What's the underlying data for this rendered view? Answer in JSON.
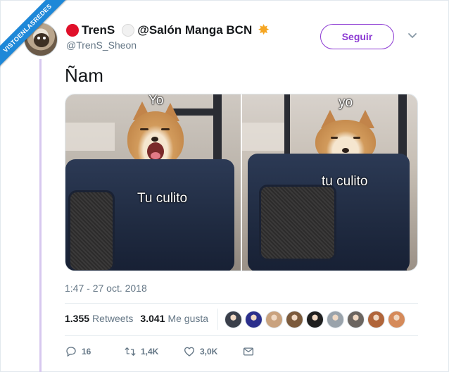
{
  "watermark": {
    "text": "VISTOENLASREDES"
  },
  "author": {
    "name_part1": "TrenS",
    "name_part2": "@Salón Manga BCN",
    "handle": "@TrenS_Sheon"
  },
  "follow_button": {
    "label": "Seguir"
  },
  "tweet": {
    "text": "Ñam",
    "timestamp": "1:47 - 27 oct. 2018"
  },
  "media": {
    "left_panel": {
      "top_label": "Yo",
      "bottom_label": "Tu culito"
    },
    "right_panel": {
      "top_label": "yo",
      "bottom_label": "tu culito"
    }
  },
  "stats": {
    "retweets_count": "1.355",
    "retweets_label": "Retweets",
    "likes_count": "3.041",
    "likes_label": "Me gusta"
  },
  "likers": [
    {
      "color": "#3a3f4a"
    },
    {
      "color": "#2b2f8c"
    },
    {
      "color": "#c9a27e"
    },
    {
      "color": "#7b5a3c"
    },
    {
      "color": "#1f1f1f"
    },
    {
      "color": "#9aa3ab"
    },
    {
      "color": "#6b6560"
    },
    {
      "color": "#b0653a"
    },
    {
      "color": "#d58a5a"
    }
  ],
  "actions": {
    "replies": "16",
    "retweets": "1,4K",
    "likes": "3,0K"
  },
  "colors": {
    "accent": "#8c3ad3",
    "thread_line": "#d7c8ef",
    "ribbon": "#1e88d8"
  }
}
